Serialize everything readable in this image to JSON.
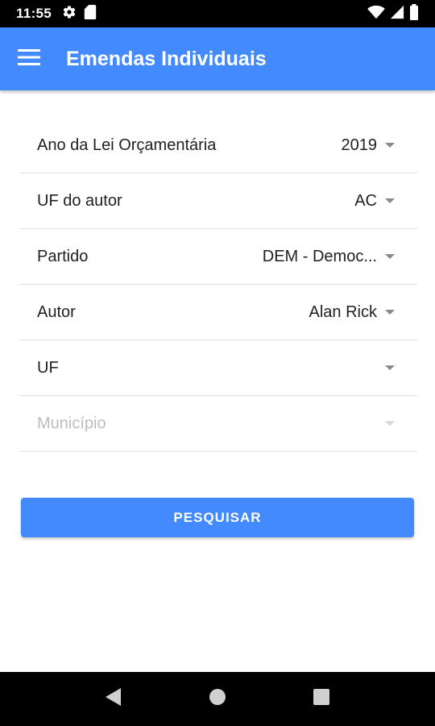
{
  "status_bar": {
    "time": "11:55",
    "left_icons": [
      "gear-icon",
      "sd-card-icon"
    ],
    "right_icons": [
      "wifi-icon",
      "signal-icon",
      "battery-icon"
    ]
  },
  "app_bar": {
    "title": "Emendas Individuais",
    "menu_icon": "hamburger-menu-icon",
    "color": "#448aff"
  },
  "form": {
    "fields": [
      {
        "label": "Ano da Lei Orçamentária",
        "value": "2019",
        "enabled": true
      },
      {
        "label": "UF do autor",
        "value": "AC",
        "enabled": true
      },
      {
        "label": "Partido",
        "value": "DEM - Democ...",
        "enabled": true
      },
      {
        "label": "Autor",
        "value": "Alan Rick",
        "enabled": true
      },
      {
        "label": "UF",
        "value": "",
        "enabled": true
      },
      {
        "label": "Município",
        "value": "",
        "enabled": false
      }
    ]
  },
  "search_button": {
    "label": "PESQUISAR",
    "color": "#448aff"
  },
  "nav_bar": {
    "buttons": [
      "back-icon",
      "home-icon",
      "recents-icon"
    ]
  }
}
